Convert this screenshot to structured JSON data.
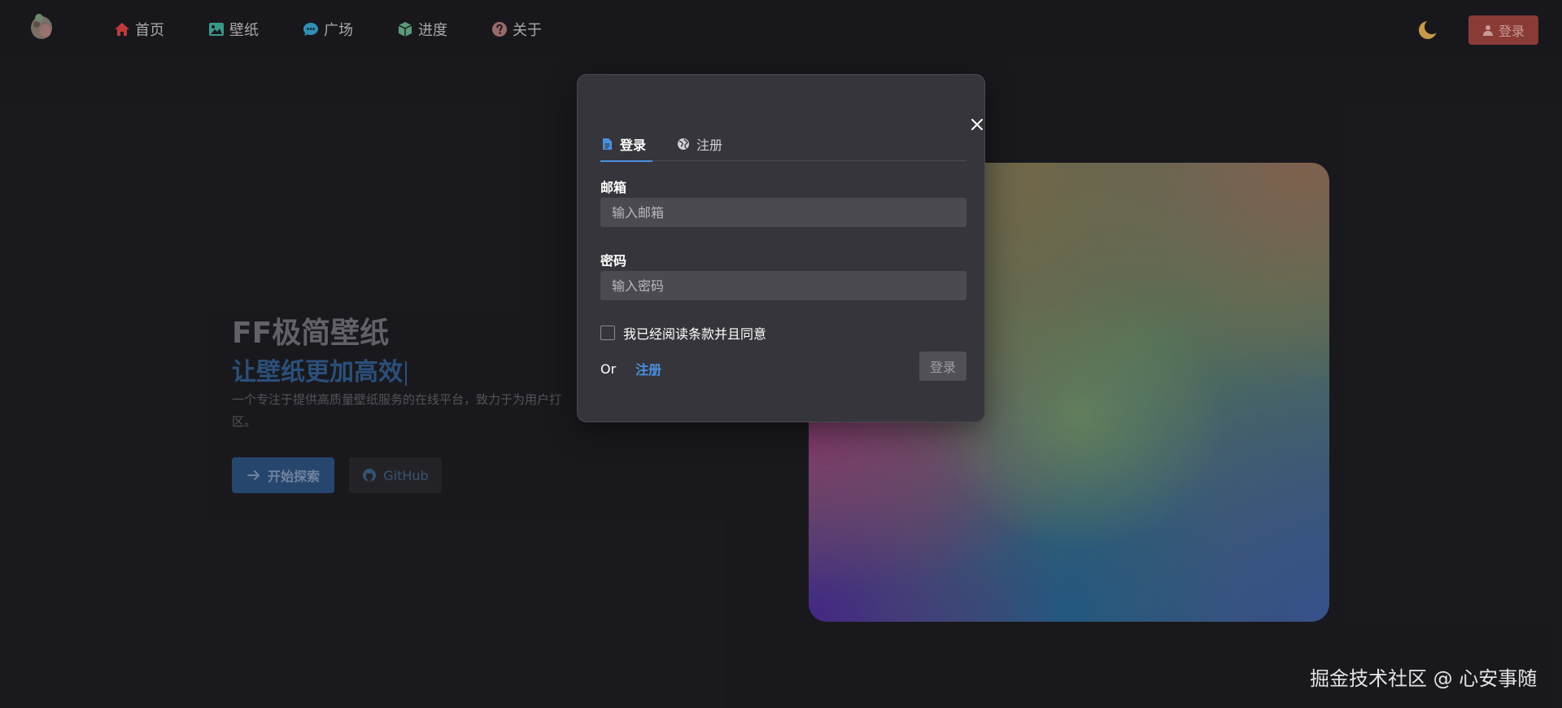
{
  "nav": {
    "items": [
      {
        "label": "首页",
        "icon": "home-icon",
        "color": "#c0393b"
      },
      {
        "label": "壁纸",
        "icon": "image-icon",
        "color": "#3a9a8a"
      },
      {
        "label": "广场",
        "icon": "chat-icon",
        "color": "#2f8fb5"
      },
      {
        "label": "进度",
        "icon": "cube-icon",
        "color": "#5a9a7a"
      },
      {
        "label": "关于",
        "icon": "question-icon",
        "color": "#9a6a6a"
      }
    ]
  },
  "header": {
    "login_label": "登录",
    "theme_icon": "moon-icon"
  },
  "hero": {
    "title": "FF极简壁纸",
    "subtitle": "让壁纸更加高效",
    "description_line1": "一个专注于提供高质量壁纸服务的在线平台，致力于为用户打",
    "description_line2": "区。",
    "explore_label": "开始探索",
    "github_label": "GitHub"
  },
  "modal": {
    "tabs": [
      {
        "label": "登录",
        "icon": "document-icon"
      },
      {
        "label": "注册",
        "icon": "globe-icon"
      }
    ],
    "email_label": "邮箱",
    "email_placeholder": "输入邮箱",
    "password_label": "密码",
    "password_placeholder": "输入密码",
    "agree_label": "我已经阅读条款并且同意",
    "or_label": "Or",
    "register_link": "注册",
    "submit_label": "登录"
  },
  "watermark": "掘金技术社区 @ 心安事随",
  "colors": {
    "accent": "#4a90e2",
    "header_login_bg": "#8a3b35",
    "explore_bg": "#2b4d78"
  }
}
